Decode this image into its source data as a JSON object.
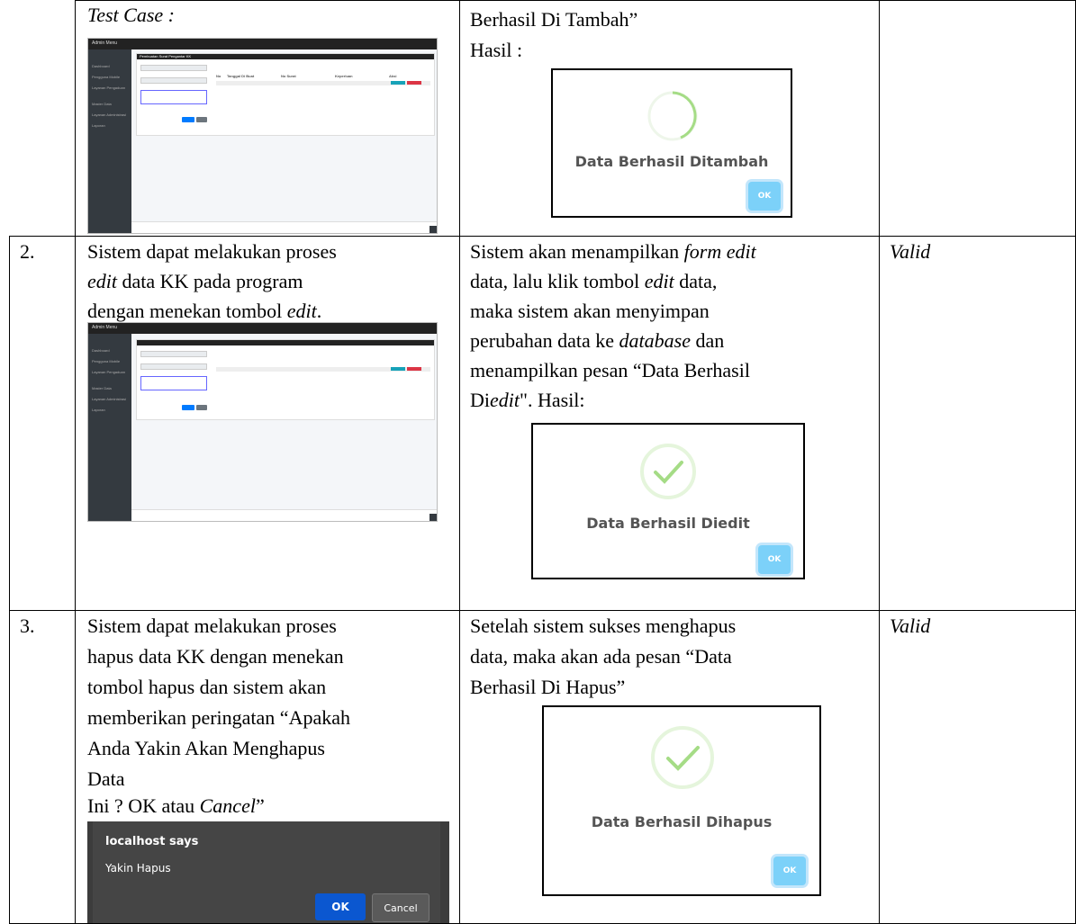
{
  "row1": {
    "left_heading": "Test Case :",
    "right_line1": "Berhasil Di Tambah”",
    "right_line2": "Hasil :",
    "dialog_message": "Data Berhasil Ditambah",
    "dialog_ok": "OK"
  },
  "row2": {
    "number": "2.",
    "left_lines": [
      "Sistem dapat melakukan proses",
      "data KK pada program",
      "dengan menekan tombol "
    ],
    "left_edit_word": "edit",
    "left_end": ".",
    "right_p1": "Sistem akan menampilkan ",
    "right_p1_i": "form edit",
    "right_p2": "data, lalu klik tombol ",
    "right_p2_i": "edit",
    "right_p2_end": " data,",
    "right_p3": "maka sistem akan menyimpan",
    "right_p4": "perubahan data ke ",
    "right_p4_i": "database",
    "right_p4_end": " dan",
    "right_p5": "menampilkan pesan “Data Berhasil",
    "right_p6a": "Di",
    "right_p6_i": "edit",
    "right_p6b": "\". Hasil:",
    "status": "Valid",
    "dialog_message": "Data Berhasil Diedit",
    "dialog_ok": "OK"
  },
  "row3": {
    "number": "3.",
    "left_lines": [
      "Sistem dapat melakukan proses",
      "hapus data KK dengan menekan",
      "tombol hapus dan sistem akan",
      "memberikan peringatan “Apakah",
      "Anda Yakin Akan Menghapus",
      "Data",
      "Ini ? OK atau "
    ],
    "left_cancel": "Cancel",
    "left_cancel_end": "”",
    "right_lines": [
      "Setelah sistem sukses menghapus",
      "data, maka akan ada pesan “Data",
      "Berhasil Di Hapus”"
    ],
    "status": "Valid",
    "dialog_message": "Data Berhasil Dihapus",
    "dialog_ok": "OK",
    "browser_title": "localhost says",
    "browser_msg": "Yakin Hapus",
    "browser_ok": "OK",
    "browser_cancel": "Cancel"
  },
  "admin_shot": {
    "brand": "Admin Menu",
    "menu": [
      "Dashboard",
      "Pengguna Mobile",
      "Layanan Pengaduan",
      "Master Data",
      "Layanan Administrasi",
      "Laporan"
    ],
    "panel_title": "Pembuatan Surat Pengantar KK",
    "table_headers": [
      "No",
      "Tanggal Di Buat",
      "No Surat",
      "Keperluan",
      "Aksi"
    ]
  },
  "colors": {
    "ok_button": "#7cd1f9",
    "success_ring": "#a5dc86",
    "browser_ok": "#0b57d0"
  }
}
